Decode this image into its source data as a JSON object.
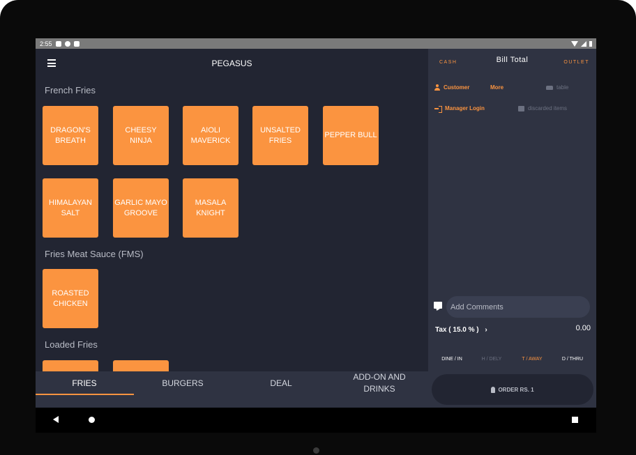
{
  "statusbar": {
    "time": "2:55"
  },
  "app": {
    "title": "PEGASUS"
  },
  "sections": [
    {
      "title": "French Fries"
    },
    {
      "title": "Fries Meat Sauce (FMS)"
    },
    {
      "title": "Loaded Fries"
    }
  ],
  "items": {
    "french_fries": [
      "DRAGON'S BREATH",
      "CHEESY NINJA",
      "AIOLI MAVERICK",
      "UNSALTED FRIES",
      "PEPPER BULL",
      "HIMALAYAN SALT",
      "GARLIC MAYO GROOVE",
      "MASALA KNIGHT"
    ],
    "fms": [
      "ROASTED CHICKEN"
    ]
  },
  "tabs": [
    "FRIES",
    "BURGERS",
    "DEAL",
    "ADD-ON AND DRINKS"
  ],
  "bill": {
    "cash": "CASH",
    "title": "Bill Total",
    "outlet": "OUTLET",
    "customer": "Customer",
    "more": "More",
    "table": "table",
    "manager_login": "Manager Login",
    "discarded_items": "discarded items",
    "comment_placeholder": "Add Comments",
    "tax_label": "Tax ( 15.0 % )",
    "tax_value": "0.00",
    "order_types": [
      "DINE / IN",
      "H / DELY",
      "T / AWAY",
      "D / THRU"
    ],
    "active_order_type": "T / AWAY",
    "order_button": "ORDER RS.  1"
  },
  "colors": {
    "accent": "#fb9440",
    "main_bg": "#222532",
    "panel_bg": "#2f3342"
  },
  "icons": [
    "menu-icon",
    "person-icon",
    "sofa-icon",
    "login-icon",
    "discard-icon",
    "comment-icon",
    "chevron-right-icon",
    "hand-pointer-icon",
    "back-icon",
    "home-icon",
    "recents-icon"
  ]
}
